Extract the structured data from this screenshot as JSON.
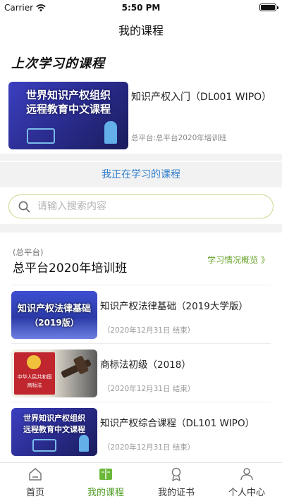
{
  "status_bar": {
    "carrier": "Carrier",
    "time": "5:50 PM"
  },
  "nav": {
    "title": "我的课程"
  },
  "last_studied": {
    "heading": "上次学习的课程",
    "course": {
      "title": "知识产权入门（DL001 WIPO）",
      "platform": "总平台:总平台2020年培训班",
      "thumb_line1": "世界知识产权组织",
      "thumb_line2": "远程教育中文课程"
    }
  },
  "studying_link": "我正在学习的课程",
  "search": {
    "placeholder": "请输入搜索内容",
    "value": ""
  },
  "class": {
    "label": "(总平台)",
    "title": "总平台2020年培训班",
    "overview_link": "学习情况概览 》"
  },
  "courses": [
    {
      "title": "知识产权法律基础（2019大学版）",
      "date": "（2020年12月31日 结束）",
      "thumb_line1": "知识产权法律基础",
      "thumb_line2": "（2019版）"
    },
    {
      "title": "商标法初级（2018）",
      "date": "（2020年12月31日 结束）",
      "thumb_line1": "中华人民共和国",
      "thumb_line2": "商标法"
    },
    {
      "title": "知识产权综合课程（DL101 WIPO）",
      "date": "（2020年12月31日 结束）",
      "thumb_line1": "世界知识产权组织",
      "thumb_line2": "远程教育中文课程"
    }
  ],
  "tabs": [
    {
      "label": "首页",
      "icon": "home-icon"
    },
    {
      "label": "我的课程",
      "icon": "book-icon",
      "active": true
    },
    {
      "label": "我的证书",
      "icon": "certificate-icon"
    },
    {
      "label": "个人中心",
      "icon": "user-icon"
    }
  ],
  "colors": {
    "accent_green": "#4a9a1e",
    "link_blue": "#2f7dcc",
    "search_border": "#c6d98a"
  }
}
